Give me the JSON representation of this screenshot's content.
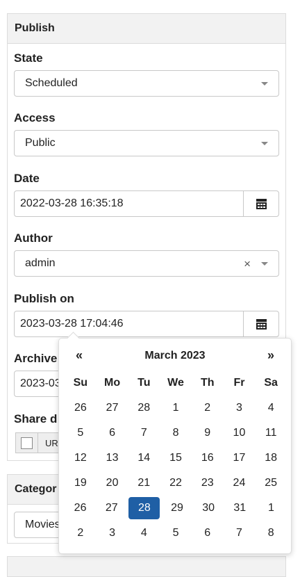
{
  "publish": {
    "title": "Publish",
    "state": {
      "label": "State",
      "value": "Scheduled"
    },
    "access": {
      "label": "Access",
      "value": "Public"
    },
    "date": {
      "label": "Date",
      "value": "2022-03-28 16:35:18"
    },
    "author": {
      "label": "Author",
      "value": "admin",
      "clear": "×"
    },
    "publish_on": {
      "label": "Publish on",
      "value": "2023-03-28 17:04:46"
    },
    "archive": {
      "label": "Archive",
      "value": "2023-03"
    },
    "share": {
      "label": "Share d",
      "url_button": "UR"
    }
  },
  "category": {
    "title": "Categor",
    "value": "Movies"
  },
  "calendar": {
    "prev": "«",
    "next": "»",
    "month": "March 2023",
    "weekdays": [
      "Su",
      "Mo",
      "Tu",
      "We",
      "Th",
      "Fr",
      "Sa"
    ],
    "weeks": [
      [
        "26",
        "27",
        "28",
        "1",
        "2",
        "3",
        "4"
      ],
      [
        "5",
        "6",
        "7",
        "8",
        "9",
        "10",
        "11"
      ],
      [
        "12",
        "13",
        "14",
        "15",
        "16",
        "17",
        "18"
      ],
      [
        "19",
        "20",
        "21",
        "22",
        "23",
        "24",
        "25"
      ],
      [
        "26",
        "27",
        "28",
        "29",
        "30",
        "31",
        "1"
      ],
      [
        "2",
        "3",
        "4",
        "5",
        "6",
        "7",
        "8"
      ]
    ],
    "selected_day": "28",
    "accent": "#1f5fa5"
  }
}
